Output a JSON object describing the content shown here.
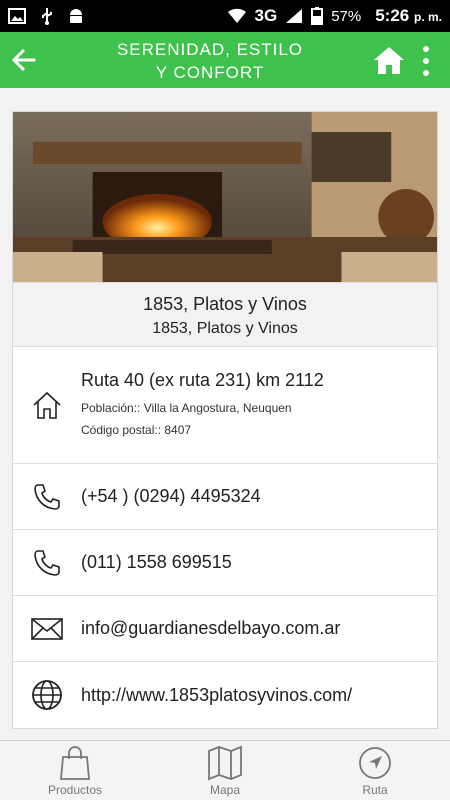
{
  "status_bar": {
    "network": "3G",
    "battery": "57%",
    "time": "5:26",
    "ampm": "p. m."
  },
  "app_bar": {
    "title_line1": "SERENIDAD, ESTILO",
    "title_line2": "Y CONFORT"
  },
  "place": {
    "name": "1853, Platos y Vinos",
    "subtitle": "1853, Platos y Vinos",
    "address": "Ruta 40 (ex ruta 231) km 2112",
    "city": "Población:: Villa la Angostura, Neuquen",
    "postal": "Código postal:: 8407",
    "phone1": "(+54 ) (0294) 4495324",
    "phone2": "(011) 1558 699515",
    "email": "info@guardianesdelbayo.com.ar",
    "website": "http://www.1853platosyvinos.com/"
  },
  "bottom_nav": {
    "items": [
      {
        "label": "Productos",
        "icon": "bag-icon"
      },
      {
        "label": "Mapa",
        "icon": "map-icon"
      },
      {
        "label": "Ruta",
        "icon": "navigation-icon"
      }
    ]
  },
  "colors": {
    "accent": "#3ec24d"
  }
}
